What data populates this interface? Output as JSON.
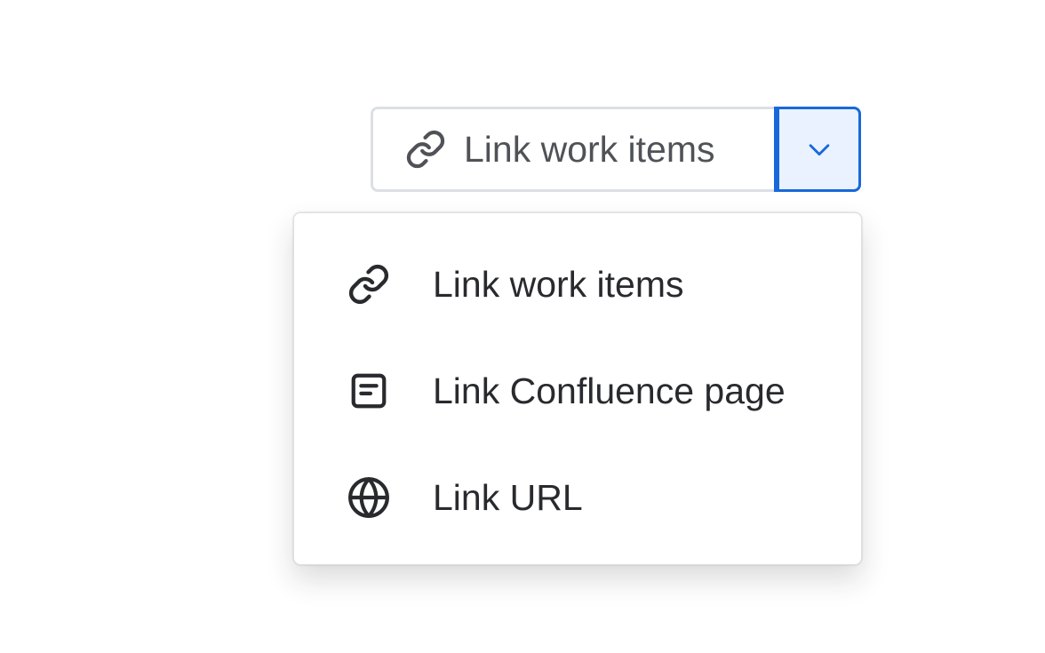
{
  "split_button": {
    "main_label": "Link work items",
    "main_icon": "link-icon",
    "toggle_icon": "chevron-down-icon",
    "accent_color": "#1868db"
  },
  "menu": {
    "items": [
      {
        "label": "Link work items",
        "icon": "link-icon"
      },
      {
        "label": "Link Confluence page",
        "icon": "page-icon"
      },
      {
        "label": "Link URL",
        "icon": "globe-icon"
      }
    ]
  }
}
